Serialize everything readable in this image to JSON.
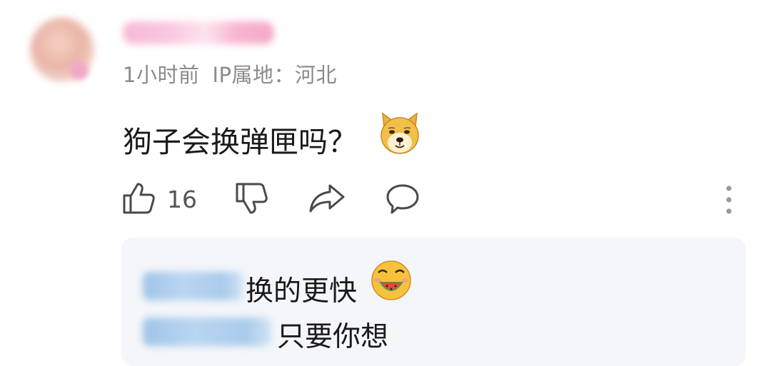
{
  "comment": {
    "time": "1小时前",
    "ip_location": "IP属地：河北",
    "text": "狗子会换弹匣吗？",
    "emoji": "doge-emoji"
  },
  "actions": {
    "like_count": "16",
    "icons": [
      "thumbs-up-icon",
      "thumbs-down-icon",
      "share-icon",
      "reply-icon",
      "more-vertical-icon"
    ]
  },
  "replies": [
    {
      "text": "换的更快",
      "emoji": "watermelon-laugh-emoji"
    },
    {
      "text": "只要你想"
    }
  ],
  "colors": {
    "meta_text": "#8a8a8a",
    "reply_bg": "#f4f6f9",
    "icon": "#4a4a4a"
  }
}
